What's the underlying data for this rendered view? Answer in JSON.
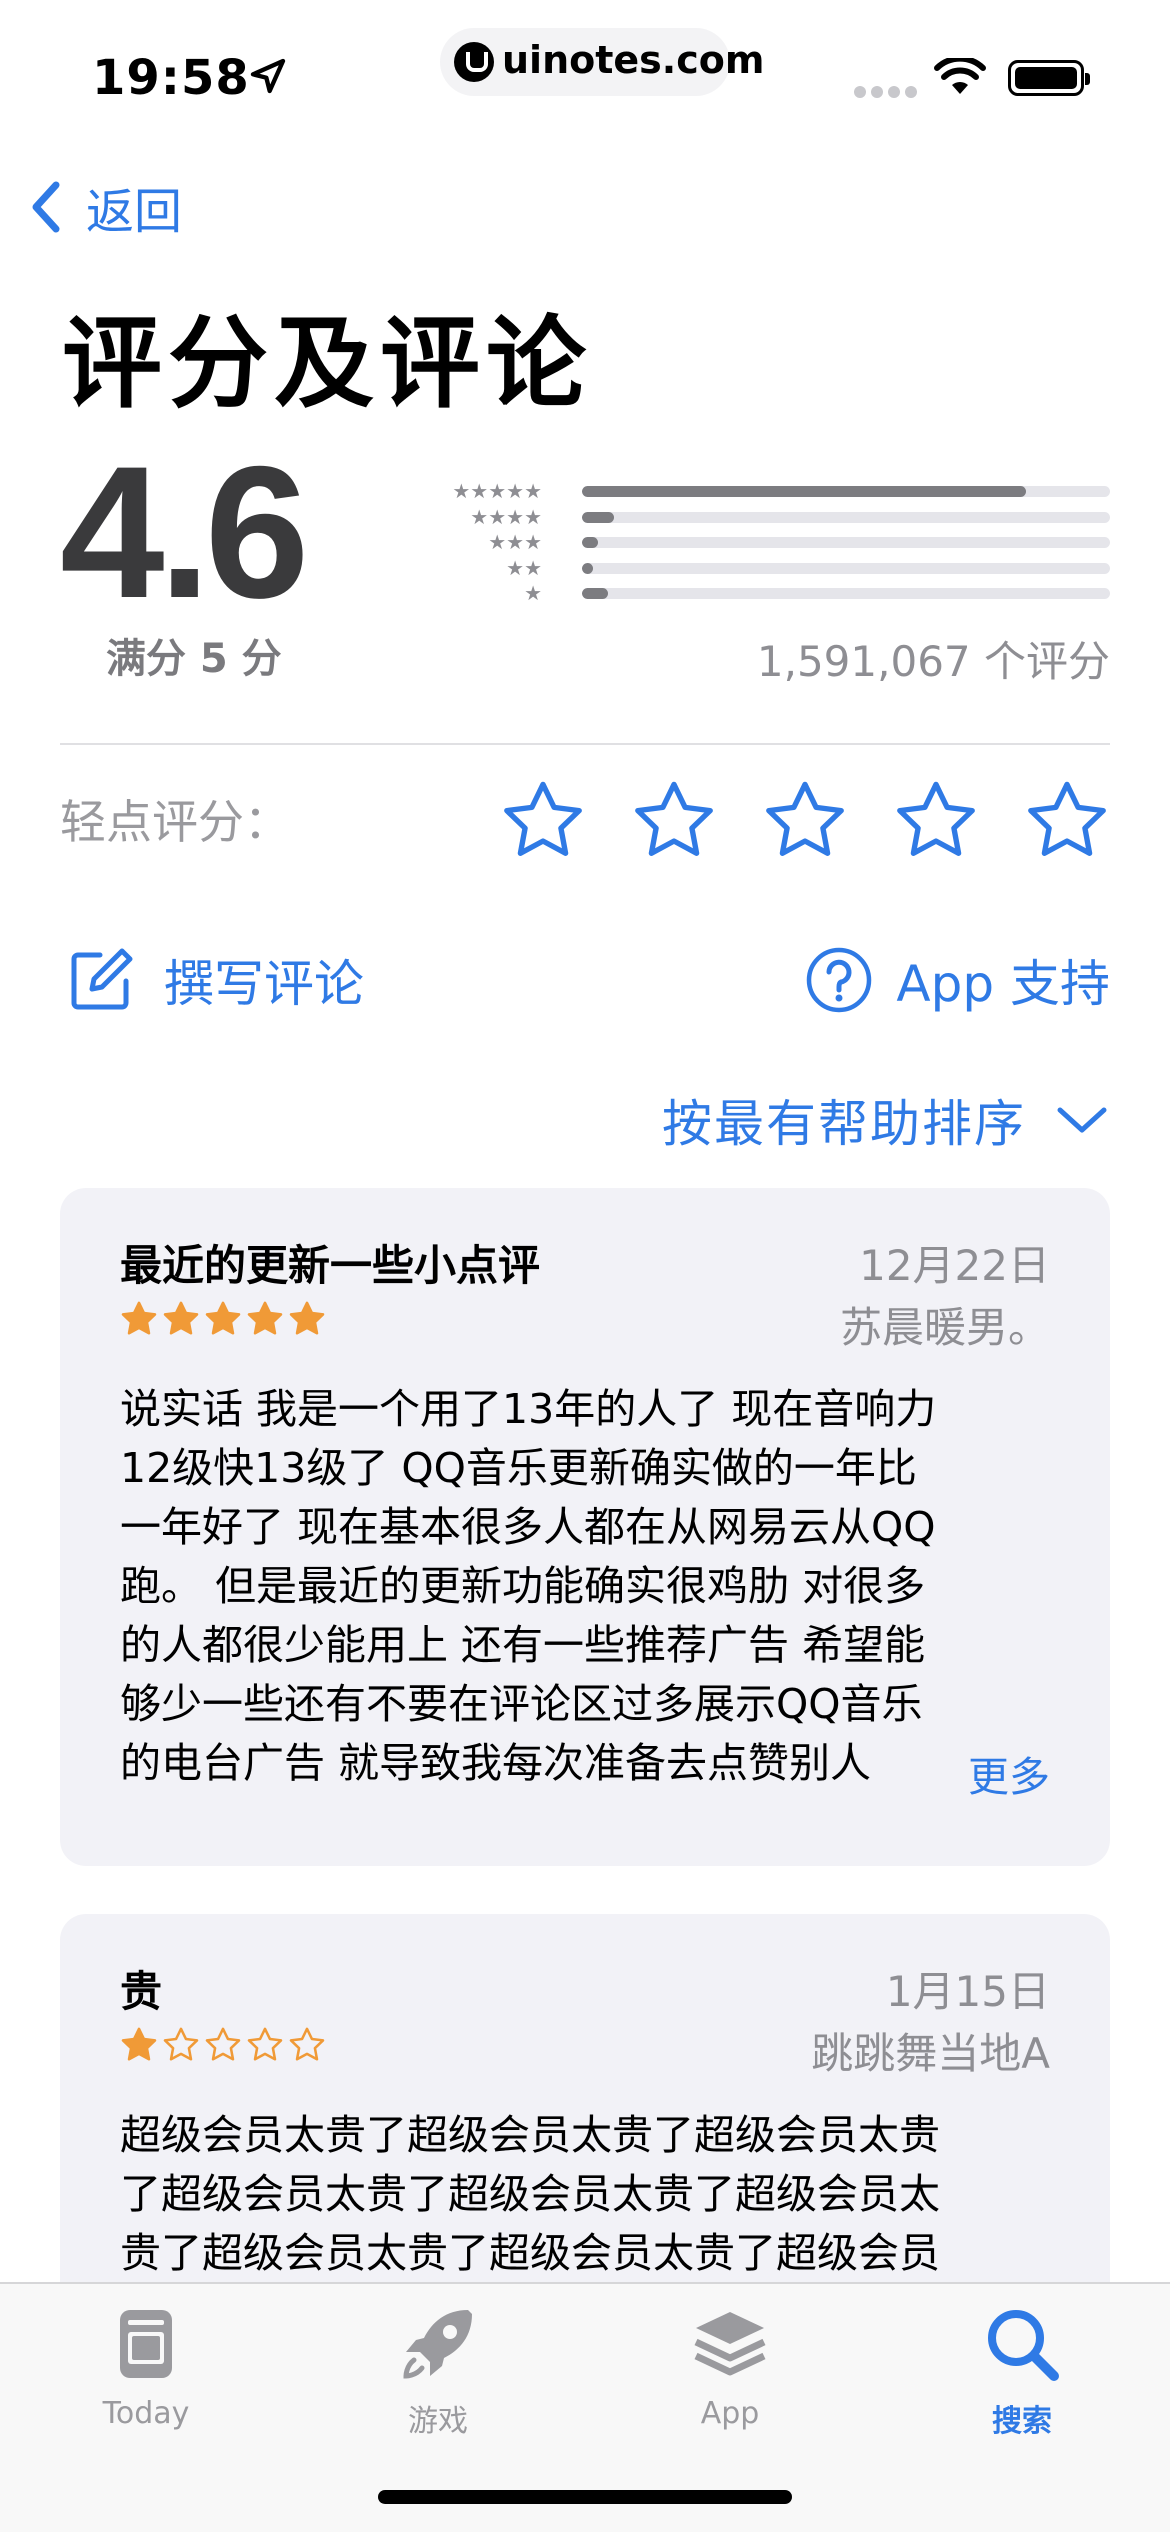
{
  "status_bar": {
    "time": "19:58",
    "url": "uinotes.com"
  },
  "nav": {
    "back_label": "返回"
  },
  "page_title": "评分及评论",
  "summary": {
    "average": "4.6",
    "out_of": "满分 5 分",
    "total_ratings": "1,591,067 个评分",
    "histogram": [
      {
        "stars": "★★★★★",
        "fraction": 0.84
      },
      {
        "stars": "★★★★",
        "fraction": 0.06
      },
      {
        "stars": "★★★",
        "fraction": 0.03
      },
      {
        "stars": "★★",
        "fraction": 0.02
      },
      {
        "stars": "★",
        "fraction": 0.05
      }
    ]
  },
  "tap_to_rate": {
    "label": "轻点评分：",
    "star_count": 5
  },
  "actions": {
    "write_review": "撰写评论",
    "app_support": "App 支持"
  },
  "sort": {
    "label": "按最有帮助排序"
  },
  "reviews": [
    {
      "title": "最近的更新一些小点评",
      "date": "12月22日",
      "author": "苏晨暖男。",
      "rating": 5,
      "lines": [
        "说实话 我是一个用了13年的人了 现在音响力",
        "12级快13级了  QQ音乐更新确实做的一年比",
        "一年好了 现在基本很多人都在从网易云从QQ",
        "跑。 但是最近的更新功能确实很鸡肋 对很多",
        "的人都很少能用上 还有一些推荐广告 希望能",
        "够少一些还有不要在评论区过多展示QQ音乐",
        "的电台广告 就导致我每次准备去点赞别人"
      ],
      "more_label": "更多"
    },
    {
      "title": "贵",
      "date": "1月15日",
      "author": "跳跳舞当地A",
      "rating": 1,
      "lines": [
        "超级会员太贵了超级会员太贵了超级会员太贵",
        "了超级会员太贵了超级会员太贵了超级会员太",
        "贵了超级会员太贵了超级会员太贵了超级会员"
      ]
    }
  ],
  "tab_bar": {
    "tabs": [
      {
        "label": "Today",
        "icon": "today-icon"
      },
      {
        "label": "游戏",
        "icon": "rocket-icon"
      },
      {
        "label": "App",
        "icon": "apps-stack-icon"
      },
      {
        "label": "搜索",
        "icon": "search-icon"
      }
    ],
    "active_index": 3
  },
  "colors": {
    "accent": "#2f7ae5",
    "star_orange": "#f09a37",
    "bar_fill": "#7c7c80",
    "card_bg": "#f2f2f7"
  }
}
